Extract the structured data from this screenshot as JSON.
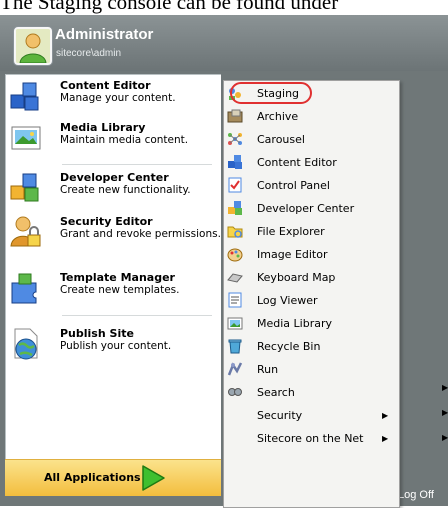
{
  "caption": "The Staging console can be found under",
  "user": {
    "name": "Administrator",
    "account": "sitecore\\admin"
  },
  "left_items": [
    {
      "title": "Content Editor",
      "desc": "Manage your content.",
      "icon": "content-editor-icon"
    },
    {
      "title": "Media Library",
      "desc": "Maintain media content.",
      "icon": "media-library-icon"
    },
    {
      "title": "Developer Center",
      "desc": "Create new functionality.",
      "icon": "developer-center-icon"
    },
    {
      "title": "Security Editor",
      "desc": "Grant and revoke permissions.",
      "icon": "security-editor-icon"
    },
    {
      "title": "Template Manager",
      "desc": "Create new templates.",
      "icon": "template-manager-icon"
    },
    {
      "title": "Publish Site",
      "desc": "Publish your content.",
      "icon": "publish-site-icon"
    }
  ],
  "all_applications": "All Applications",
  "log_off": "Log Off",
  "submenu": [
    {
      "label": "Staging",
      "icon": "staging-icon",
      "highlighted": true
    },
    {
      "label": "Archive",
      "icon": "archive-icon"
    },
    {
      "label": "Carousel",
      "icon": "carousel-icon"
    },
    {
      "label": "Content Editor",
      "icon": "content-editor-icon"
    },
    {
      "label": "Control Panel",
      "icon": "control-panel-icon"
    },
    {
      "label": "Developer Center",
      "icon": "developer-center-icon"
    },
    {
      "label": "File Explorer",
      "icon": "file-explorer-icon"
    },
    {
      "label": "Image Editor",
      "icon": "image-editor-icon"
    },
    {
      "label": "Keyboard Map",
      "icon": "keyboard-map-icon"
    },
    {
      "label": "Log Viewer",
      "icon": "log-viewer-icon"
    },
    {
      "label": "Media Library",
      "icon": "media-library-icon"
    },
    {
      "label": "Recycle Bin",
      "icon": "recycle-bin-icon"
    },
    {
      "label": "Run",
      "icon": "run-icon"
    },
    {
      "label": "Search",
      "icon": "search-icon"
    },
    {
      "label": "Security",
      "icon": "",
      "has_submenu": true
    },
    {
      "label": "Sitecore on the Net",
      "icon": "",
      "has_submenu": true
    }
  ],
  "colors": {
    "frame": "#6f7778",
    "highlight_ring": "#e03030",
    "all_apps": "#f3bd3d"
  }
}
